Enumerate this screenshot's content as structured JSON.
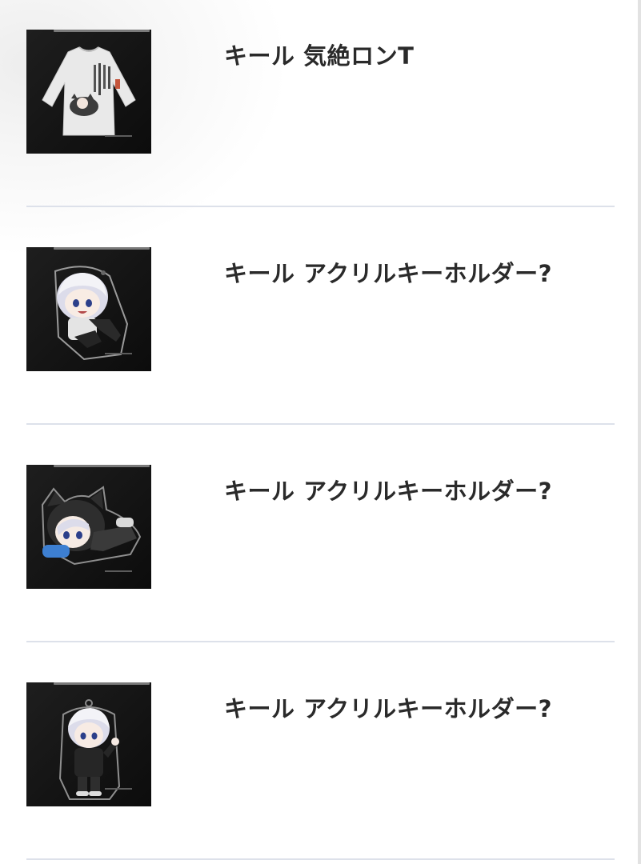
{
  "product_list": {
    "items": [
      {
        "title": "キール 気絶ロンT",
        "thumbnail": "long-sleeve-tshirt-image"
      },
      {
        "title": "キール アクリルキーホルダー?",
        "thumbnail": "acrylic-keychain-sitting-image"
      },
      {
        "title": "キール アクリルキーホルダー?",
        "thumbnail": "acrylic-keychain-cat-hood-image"
      },
      {
        "title": "キール アクリルキーホルダー?",
        "thumbnail": "acrylic-keychain-standing-image"
      }
    ]
  },
  "colors": {
    "divider": "#dde1ea",
    "thumbnail_bg": "#161616",
    "title_text": "#2a2a2a"
  }
}
